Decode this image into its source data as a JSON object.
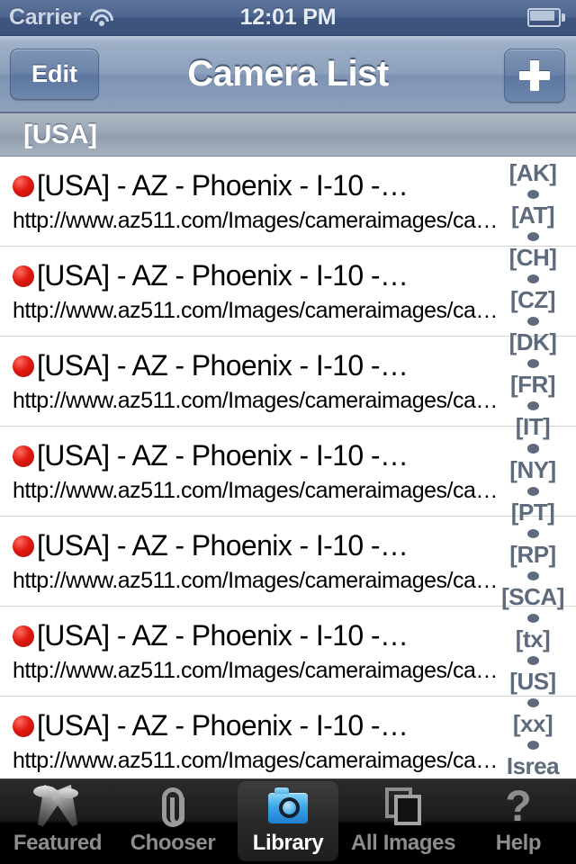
{
  "statusbar": {
    "carrier": "Carrier",
    "time": "12:01 PM",
    "wifi_icon": "wifi-icon",
    "battery_icon": "battery-icon"
  },
  "navbar": {
    "title": "Camera List",
    "edit_label": "Edit",
    "add_label": "+"
  },
  "section": {
    "header": "[USA]"
  },
  "list": {
    "rows": [
      {
        "title": "[USA] - AZ - Phoenix - I-10 -…",
        "url": "http://www.az511.com/Images/cameraimages/ca…",
        "status_color": "#e01a12"
      },
      {
        "title": "[USA] - AZ - Phoenix - I-10 -…",
        "url": "http://www.az511.com/Images/cameraimages/ca…",
        "status_color": "#e01a12"
      },
      {
        "title": "[USA] - AZ - Phoenix - I-10 -…",
        "url": "http://www.az511.com/Images/cameraimages/ca…",
        "status_color": "#e01a12"
      },
      {
        "title": "[USA] - AZ - Phoenix - I-10 -…",
        "url": "http://www.az511.com/Images/cameraimages/ca…",
        "status_color": "#e01a12"
      },
      {
        "title": "[USA] - AZ - Phoenix - I-10 -…",
        "url": "http://www.az511.com/Images/cameraimages/ca…",
        "status_color": "#e01a12"
      },
      {
        "title": "[USA] - AZ - Phoenix - I-10 -…",
        "url": "http://www.az511.com/Images/cameraimages/ca…",
        "status_color": "#e01a12"
      },
      {
        "title": "[USA] - AZ - Phoenix - I-10 -…",
        "url": "http://www.az511.com/Images/cameraimages/ca…",
        "status_color": "#e01a12"
      }
    ]
  },
  "index_bar": {
    "entries": [
      "[AK]",
      "[AT]",
      "[CH]",
      "[CZ]",
      "[DK]",
      "[FR]",
      "[IT]",
      "[NY]",
      "[PT]",
      "[RP]",
      "[SCA]",
      "[tx]",
      "[US]",
      "[xx]",
      "Isrea"
    ]
  },
  "tabbar": {
    "tabs": [
      {
        "label": "Featured",
        "icon": "crossed-pennants-icon",
        "selected": false
      },
      {
        "label": "Chooser",
        "icon": "paperclip-icon",
        "selected": false
      },
      {
        "label": "Library",
        "icon": "camera-icon",
        "selected": true
      },
      {
        "label": "All Images",
        "icon": "photo-stack-icon",
        "selected": false
      },
      {
        "label": "Help",
        "icon": "question-mark-icon",
        "selected": false
      }
    ]
  },
  "colors": {
    "navbar_tint": "#8ca0bc",
    "status_dot": "#e01a12",
    "index_text": "#5e6b7d",
    "tab_selected_text": "#ffffff",
    "tab_text": "#8d8d8d"
  }
}
